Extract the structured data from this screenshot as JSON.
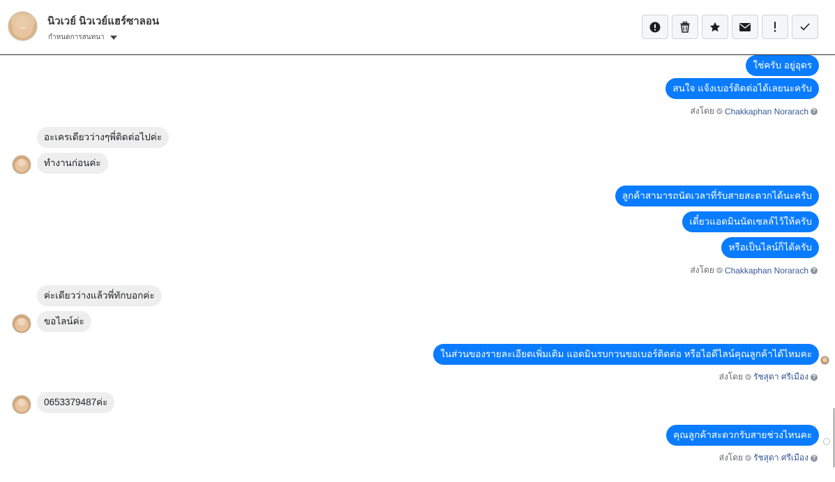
{
  "header": {
    "contact_name": "นิวเวย์ นิวเวย์แฮร์ซาลอน",
    "status_label": "กำหนดการสนทนา",
    "actions": [
      "report",
      "delete",
      "star",
      "mark-unread",
      "spam",
      "done"
    ]
  },
  "messages": [
    {
      "dir": "out",
      "text": "ใช่ครับ อยู่อุดร"
    },
    {
      "dir": "out",
      "text": "สนใจ แจ้งเบอร์ติดต่อได้เลยนะครับ"
    },
    {
      "dir": "in",
      "text": "อะเครเดียวว่างๆพี่ติดต่อไปค่ะ"
    },
    {
      "dir": "in",
      "text": "ทำงานก่อนค่ะ"
    },
    {
      "dir": "out",
      "text": "ลูกค้าสามารถนัดเวลาที่รับสายสะดวกได้นะครับ"
    },
    {
      "dir": "out",
      "text": "เดี๋ยวแอดมินนัดเซลล์ไว้ให้ครับ"
    },
    {
      "dir": "out",
      "text": "หรือเป็นไลน์ก็ได้ครับ"
    },
    {
      "dir": "in",
      "text": "ค่ะเดียวว่างแล้วพี่ทักบอกค่ะ"
    },
    {
      "dir": "in",
      "text": "ขอไลน์ค่ะ"
    },
    {
      "dir": "out",
      "text": "ในส่วนของรายละเอียดเพิ่มเติม แอดมินรบกวนขอเบอร์ติดต่อ หรือไอดีไลน์คุณลูกค้าได้ไหมคะ"
    },
    {
      "dir": "in",
      "text": "0653379487ค่ะ"
    },
    {
      "dir": "out",
      "text": "คุณลูกค้าสะดวกรับสายช่วงไหนคะ"
    }
  ],
  "sent_by": [
    {
      "prefix": "ส่งโดย",
      "agent": "Chakkaphan Norarach"
    },
    {
      "prefix": "ส่งโดย",
      "agent": "Chakkaphan Norarach"
    },
    {
      "prefix": "ส่งโดย",
      "agent": "รัชสุดา ศรีเมือง"
    },
    {
      "prefix": "ส่งโดย",
      "agent": "รัชสุดา ศรีเมือง"
    }
  ],
  "icons": {
    "help": "?",
    "colors": {
      "outgoing": "#0a7cff",
      "incoming": "#eeeeee",
      "agent": "#385898"
    }
  }
}
